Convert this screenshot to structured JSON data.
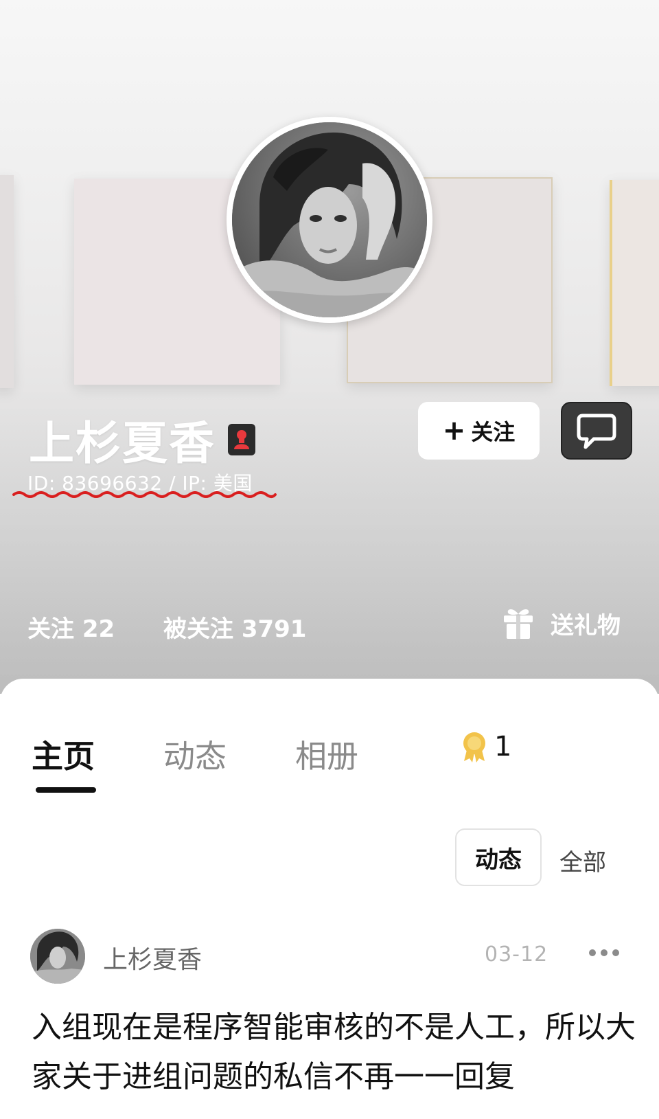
{
  "profile": {
    "name": "上杉夏香",
    "id_line": "ID: 83696632 / IP: 美国",
    "follow_label": "关注",
    "follow_plus": "+",
    "following": "关注 22",
    "followers": "被关注 3791",
    "gift_label": "送礼物"
  },
  "tabs": [
    {
      "label": "主页",
      "active": true
    },
    {
      "label": "动态",
      "active": false
    },
    {
      "label": "相册",
      "active": false
    }
  ],
  "medal_count": "1",
  "filters": {
    "active": "动态",
    "all": "全部"
  },
  "post": {
    "author": "上杉夏香",
    "date": "03-12",
    "text": "入组现在是程序智能审核的不是人工，所以大家关于进组问题的私信不再一一回复"
  },
  "colors": {
    "accent_red": "#e8393d",
    "badge_bg": "#2b2b2b",
    "squiggle": "#d91f1f",
    "medal_gold": "#f2c34a"
  }
}
